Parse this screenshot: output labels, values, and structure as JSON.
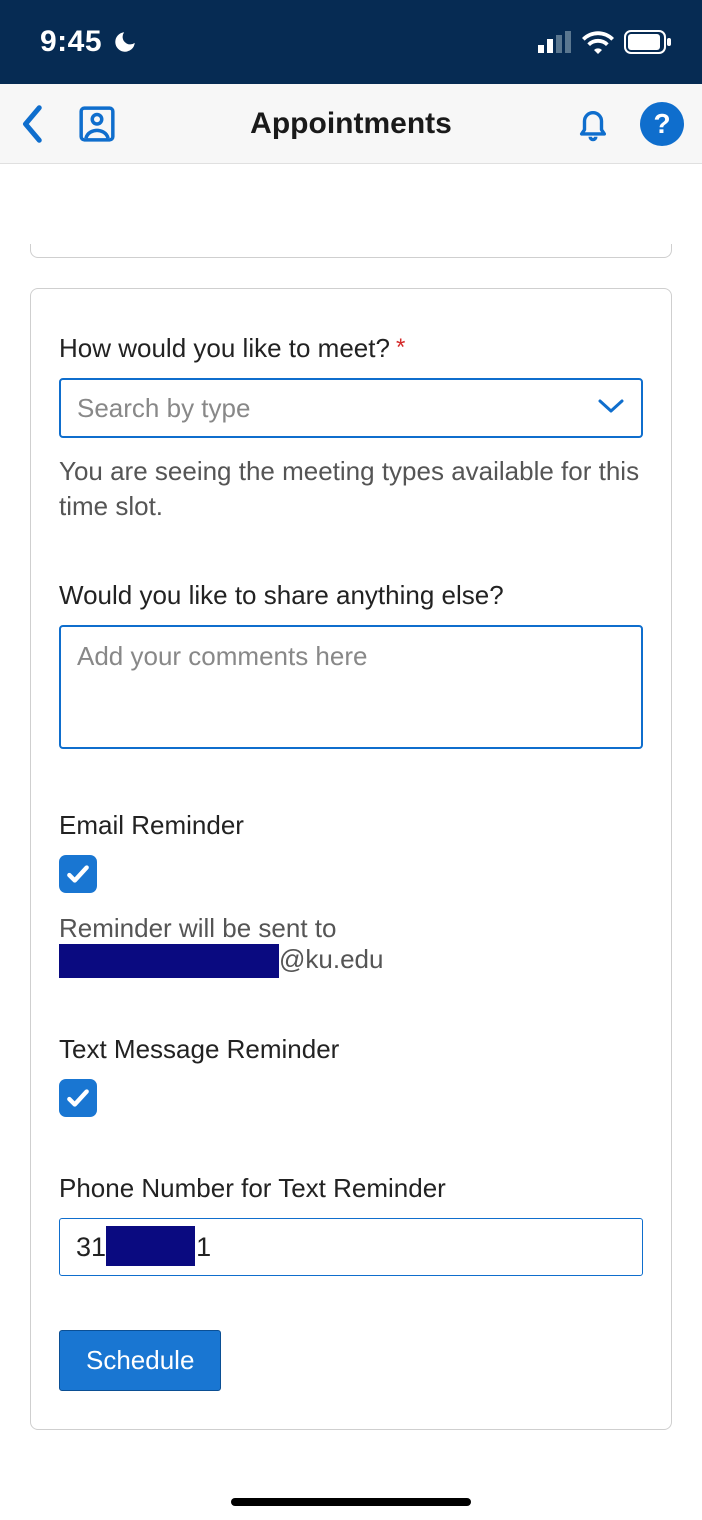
{
  "statusbar": {
    "time": "9:45"
  },
  "header": {
    "title": "Appointments"
  },
  "form": {
    "meet": {
      "label": "How would you like to meet?",
      "placeholder": "Search by type",
      "help": "You are seeing the meeting types available for this time slot."
    },
    "comments": {
      "label": "Would you like to share anything else?",
      "placeholder": "Add your comments here"
    },
    "emailReminder": {
      "label": "Email Reminder",
      "checked": true,
      "sentTo": "Reminder will be sent to",
      "emailSuffix": "@ku.edu"
    },
    "textReminder": {
      "label": "Text Message Reminder",
      "checked": true
    },
    "phone": {
      "label": "Phone Number for Text Reminder",
      "valuePrefix": "31",
      "valueSuffix": "01"
    },
    "scheduleLabel": "Schedule"
  }
}
